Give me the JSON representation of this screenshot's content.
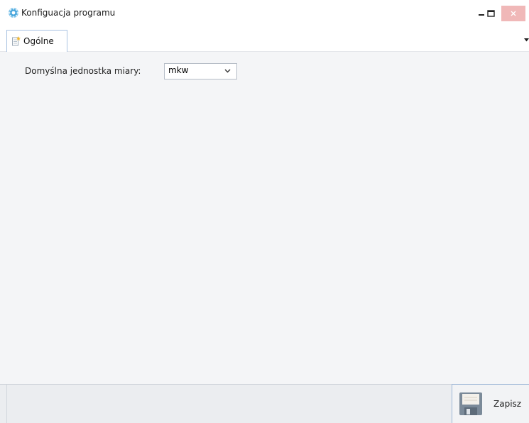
{
  "window": {
    "title": "Konfiguacja programu",
    "icon": "gear-icon",
    "controls": [
      "minimize",
      "maximize",
      "close"
    ]
  },
  "tabs": [
    {
      "label": "Ogólne",
      "icon": "document-star-icon",
      "active": true
    }
  ],
  "form": {
    "unit_label": "Domyślna jednostka miary:",
    "unit_value": "mkw"
  },
  "footer": {
    "save_label": "Zapisz",
    "save_icon": "floppy-disk-icon"
  },
  "colors": {
    "accent_border": "#9fb8d8",
    "close_button": "#f0b8b8",
    "content_bg": "#f4f5f7",
    "footer_bg": "#ebedf0"
  }
}
